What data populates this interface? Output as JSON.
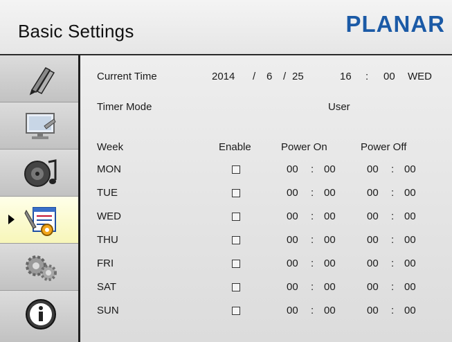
{
  "header": {
    "title": "Basic Settings",
    "logo": "PLANAR"
  },
  "sidebar": {
    "items": [
      {
        "icon": "pens-icon"
      },
      {
        "icon": "monitor-icon"
      },
      {
        "icon": "audio-icon"
      },
      {
        "icon": "settings-tools-icon",
        "selected": true
      },
      {
        "icon": "gears-icon"
      },
      {
        "icon": "info-icon"
      }
    ]
  },
  "current_time": {
    "label": "Current Time",
    "year": "2014",
    "sep1": "/",
    "month": "6",
    "sep2": "/",
    "day": "25",
    "hour": "16",
    "colon": ":",
    "minute": "00",
    "weekday": "WED"
  },
  "timer_mode": {
    "label": "Timer Mode",
    "value": "User"
  },
  "schedule": {
    "headers": {
      "week": "Week",
      "enable": "Enable",
      "power_on": "Power On",
      "power_off": "Power Off"
    },
    "rows": [
      {
        "day": "MON",
        "enabled": false,
        "on_h": "00",
        "on_m": "00",
        "off_h": "00",
        "off_m": "00"
      },
      {
        "day": "TUE",
        "enabled": false,
        "on_h": "00",
        "on_m": "00",
        "off_h": "00",
        "off_m": "00"
      },
      {
        "day": "WED",
        "enabled": false,
        "on_h": "00",
        "on_m": "00",
        "off_h": "00",
        "off_m": "00"
      },
      {
        "day": "THU",
        "enabled": false,
        "on_h": "00",
        "on_m": "00",
        "off_h": "00",
        "off_m": "00"
      },
      {
        "day": "FRI",
        "enabled": false,
        "on_h": "00",
        "on_m": "00",
        "off_h": "00",
        "off_m": "00"
      },
      {
        "day": "SAT",
        "enabled": false,
        "on_h": "00",
        "on_m": "00",
        "off_h": "00",
        "off_m": "00"
      },
      {
        "day": "SUN",
        "enabled": false,
        "on_h": "00",
        "on_m": "00",
        "off_h": "00",
        "off_m": "00"
      }
    ],
    "colon": ":"
  }
}
